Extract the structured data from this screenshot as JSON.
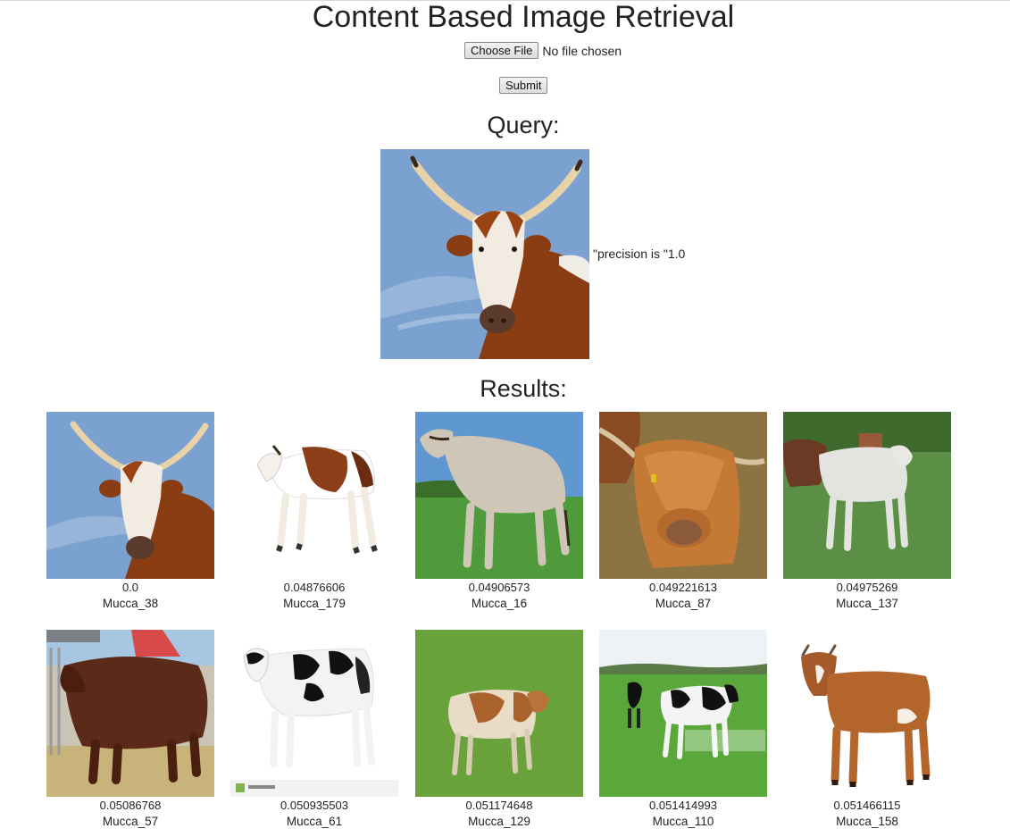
{
  "header": {
    "title": "Content Based Image Retrieval"
  },
  "upload": {
    "choose_label": "Choose File",
    "file_status": "No file chosen",
    "submit_label": "Submit"
  },
  "query": {
    "heading": "Query:",
    "precision_text": "\"precision is \"1.0"
  },
  "results": {
    "heading": "Results:",
    "items": [
      {
        "score": "0.0",
        "name": "Mucca_38"
      },
      {
        "score": "0.04876606",
        "name": "Mucca_179"
      },
      {
        "score": "0.04906573",
        "name": "Mucca_16"
      },
      {
        "score": "0.049221613",
        "name": "Mucca_87"
      },
      {
        "score": "0.04975269",
        "name": "Mucca_137"
      },
      {
        "score": "0.05086768",
        "name": "Mucca_57"
      },
      {
        "score": "0.050935503",
        "name": "Mucca_61"
      },
      {
        "score": "0.051174648",
        "name": "Mucca_129"
      },
      {
        "score": "0.051414993",
        "name": "Mucca_110"
      },
      {
        "score": "0.051466115",
        "name": "Mucca_158"
      }
    ]
  },
  "colors": {
    "sky": "#6f9ac9",
    "grass": "#5e9a3a",
    "cow_brown": "#8a3d12",
    "white_bg": "#ffffff"
  }
}
